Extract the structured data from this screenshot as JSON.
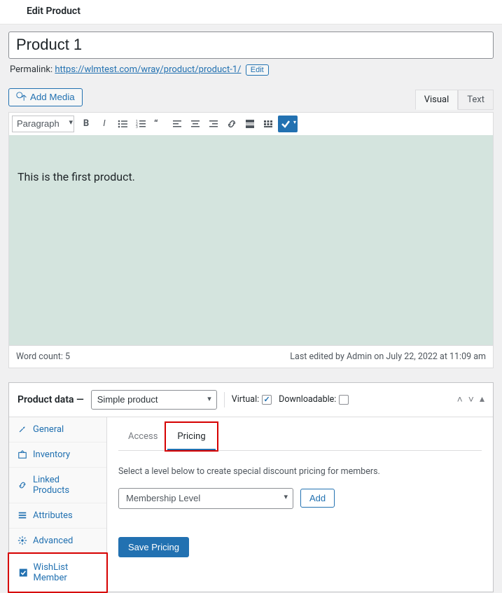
{
  "header": {
    "title": "Edit Product"
  },
  "title_field": {
    "value": "Product 1"
  },
  "permalink": {
    "label": "Permalink:",
    "url": "https://wlmtest.com/wray/product/product-1/",
    "edit_label": "Edit"
  },
  "media": {
    "add_label": "Add Media"
  },
  "editor_tabs": {
    "visual": "Visual",
    "text": "Text"
  },
  "toolbar": {
    "paragraph_label": "Paragraph"
  },
  "editor_body": {
    "content": "This is the first product."
  },
  "editor_footer": {
    "word_count": "Word count: 5",
    "last_edited": "Last edited by Admin on July 22, 2022 at 11:09 am"
  },
  "product_data": {
    "header_label": "Product data —",
    "type_selected": "Simple product",
    "virtual_label": "Virtual:",
    "virtual_checked": true,
    "downloadable_label": "Downloadable:",
    "downloadable_checked": false
  },
  "side_tabs": {
    "general": "General",
    "inventory": "Inventory",
    "linked": "Linked Products",
    "attributes": "Attributes",
    "advanced": "Advanced",
    "wlm": "WishList Member"
  },
  "inner_tabs": {
    "access": "Access",
    "pricing": "Pricing"
  },
  "panel": {
    "desc": "Select a level below to create special discount pricing for members.",
    "level_placeholder": "Membership Level",
    "add_label": "Add",
    "save_label": "Save Pricing"
  }
}
